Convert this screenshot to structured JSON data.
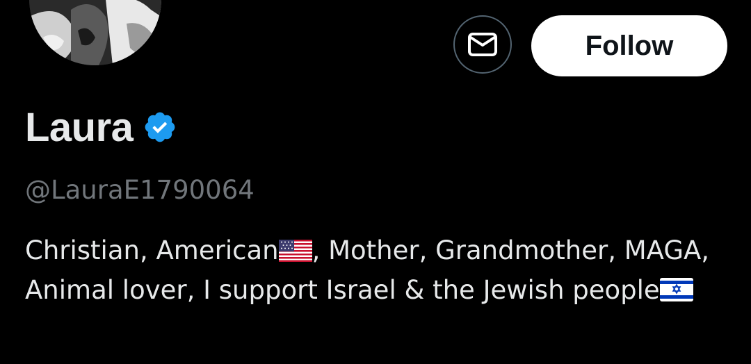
{
  "profile": {
    "display_name": "Laura",
    "handle": "@LauraE1790064",
    "bio_part1": "Christian, American",
    "bio_part2": ", Mother, Grandmother, MAGA, Animal lover, I support Israel & the Jewish people",
    "flag1": "us-flag-icon",
    "flag2": "israel-flag-icon",
    "verified": true
  },
  "actions": {
    "message_icon": "envelope-icon",
    "follow_label": "Follow"
  },
  "colors": {
    "background": "#000000",
    "verified_blue": "#1d9bf0",
    "handle_gray": "#71767b",
    "button_border": "#536471"
  }
}
